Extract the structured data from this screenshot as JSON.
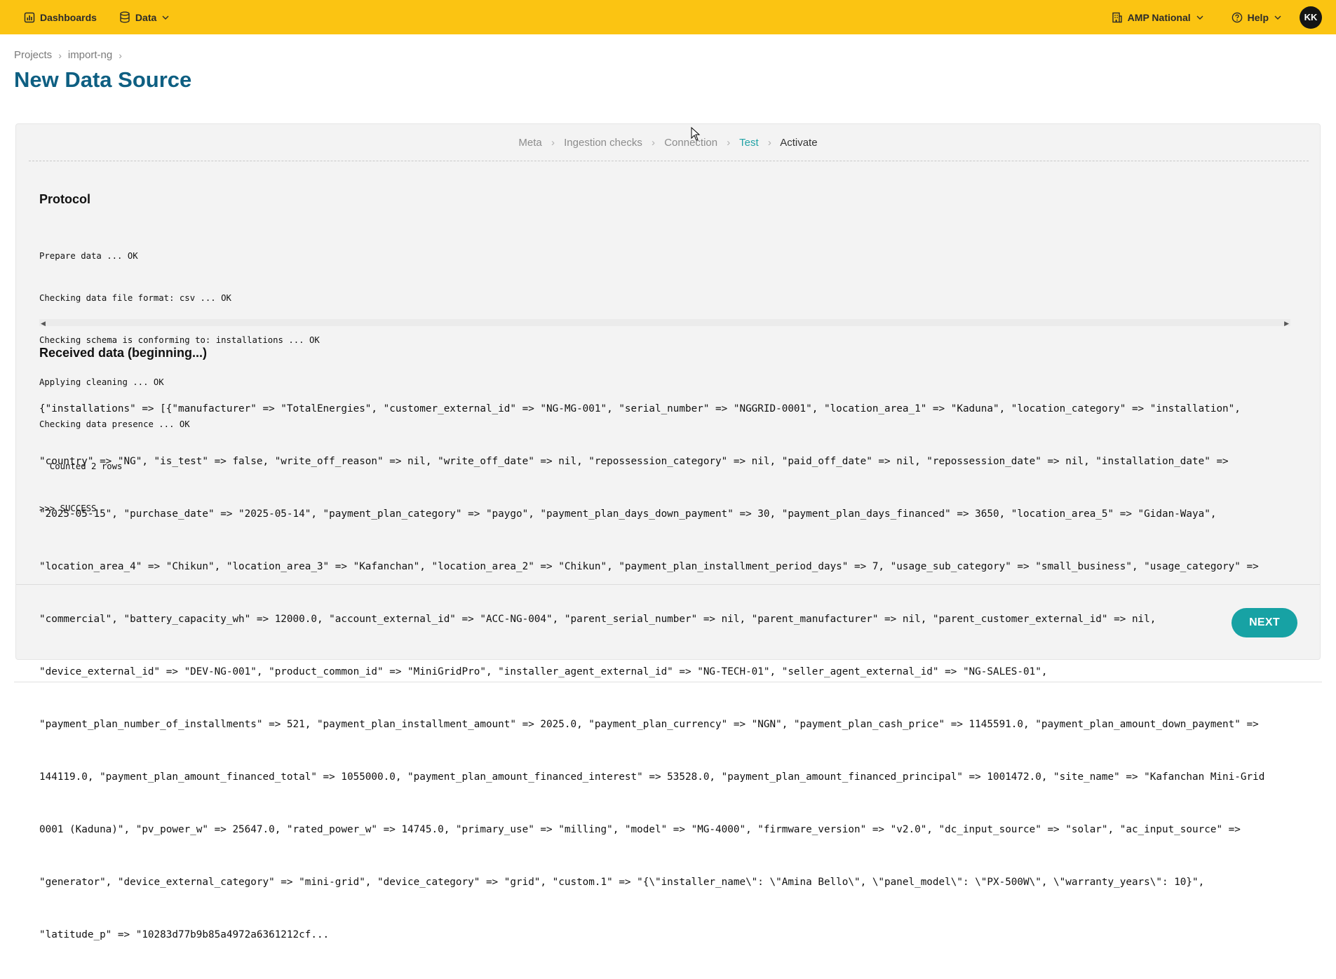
{
  "topbar": {
    "dashboards_label": "Dashboards",
    "data_label": "Data",
    "org_label": "AMP National",
    "help_label": "Help",
    "avatar_initials": "KK",
    "background_color": "#fbc412"
  },
  "breadcrumb": [
    "Projects",
    "import-ng"
  ],
  "page_title": "New Data Source",
  "steps": {
    "items": [
      "Meta",
      "Ingestion checks",
      "Connection",
      "Test",
      "Activate"
    ],
    "active": "Test",
    "current": "Activate"
  },
  "protocol": {
    "title": "Protocol",
    "lines": [
      "Prepare data ... OK",
      "Checking data file format: csv ... OK",
      "Checking schema is conforming to: installations ... OK",
      "Applying cleaning ... OK",
      "Checking data presence ... OK",
      "  Counted 2 rows",
      ">>> SUCCESS"
    ]
  },
  "received": {
    "title": "Received data (beginning...)",
    "lines": [
      "{\"installations\" => [{\"manufacturer\" => \"TotalEnergies\", \"customer_external_id\" => \"NG-MG-001\", \"serial_number\" => \"NGGRID-0001\", \"location_area_1\" => \"Kaduna\", \"location_category\" => \"installation\",",
      "\"country\" => \"NG\", \"is_test\" => false, \"write_off_reason\" => nil, \"write_off_date\" => nil, \"repossession_category\" => nil, \"paid_off_date\" => nil, \"repossession_date\" => nil, \"installation_date\" =>",
      "\"2025-05-15\", \"purchase_date\" => \"2025-05-14\", \"payment_plan_category\" => \"paygo\", \"payment_plan_days_down_payment\" => 30, \"payment_plan_days_financed\" => 3650, \"location_area_5\" => \"Gidan-Waya\",",
      "\"location_area_4\" => \"Chikun\", \"location_area_3\" => \"Kafanchan\", \"location_area_2\" => \"Chikun\", \"payment_plan_installment_period_days\" => 7, \"usage_sub_category\" => \"small_business\", \"usage_category\" =>",
      "\"commercial\", \"battery_capacity_wh\" => 12000.0, \"account_external_id\" => \"ACC-NG-004\", \"parent_serial_number\" => nil, \"parent_manufacturer\" => nil, \"parent_customer_external_id\" => nil,",
      "\"device_external_id\" => \"DEV-NG-001\", \"product_common_id\" => \"MiniGridPro\", \"installer_agent_external_id\" => \"NG-TECH-01\", \"seller_agent_external_id\" => \"NG-SALES-01\",",
      "\"payment_plan_number_of_installments\" => 521, \"payment_plan_installment_amount\" => 2025.0, \"payment_plan_currency\" => \"NGN\", \"payment_plan_cash_price\" => 1145591.0, \"payment_plan_amount_down_payment\" =>",
      "144119.0, \"payment_plan_amount_financed_total\" => 1055000.0, \"payment_plan_amount_financed_interest\" => 53528.0, \"payment_plan_amount_financed_principal\" => 1001472.0, \"site_name\" => \"Kafanchan Mini-Grid",
      "0001 (Kaduna)\", \"pv_power_w\" => 25647.0, \"rated_power_w\" => 14745.0, \"primary_use\" => \"milling\", \"model\" => \"MG-4000\", \"firmware_version\" => \"v2.0\", \"dc_input_source\" => \"solar\", \"ac_input_source\" =>",
      "\"generator\", \"device_external_category\" => \"mini-grid\", \"device_category\" => \"grid\", \"custom.1\" => \"{\\\"installer_name\\\": \\\"Amina Bello\\\", \\\"panel_model\\\": \\\"PX-500W\\\", \\\"warranty_years\\\": 10}\",",
      "\"latitude_p\" => \"10283d77b9b85a4972a6361212cf..."
    ]
  },
  "next_label": "NEXT"
}
